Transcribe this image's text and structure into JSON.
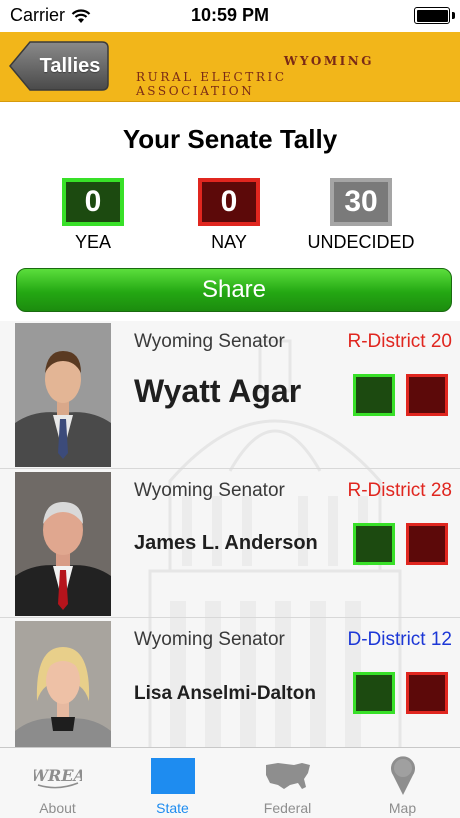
{
  "status_bar": {
    "carrier": "Carrier",
    "time": "10:59 PM"
  },
  "header": {
    "back_label": "Tallies",
    "logo_line1": "WYOMING",
    "logo_line2": "RURAL ELECTRIC ASSOCIATION"
  },
  "tally": {
    "title": "Your Senate Tally",
    "yea": {
      "count": "0",
      "label": "YEA"
    },
    "nay": {
      "count": "0",
      "label": "NAY"
    },
    "undecided": {
      "count": "30",
      "label": "UNDECIDED"
    }
  },
  "share_label": "Share",
  "senators": [
    {
      "role": "Wyoming Senator",
      "district": "R-District 20",
      "party": "R",
      "name": "Wyatt Agar"
    },
    {
      "role": "Wyoming Senator",
      "district": "R-District 28",
      "party": "R",
      "name": "James L. Anderson"
    },
    {
      "role": "Wyoming Senator",
      "district": "D-District 12",
      "party": "D",
      "name": "Lisa Anselmi-Dalton"
    }
  ],
  "tabs": [
    {
      "label": "About",
      "icon": "wrea-logo-icon",
      "active": false
    },
    {
      "label": "State",
      "icon": "wyoming-state-icon",
      "active": true
    },
    {
      "label": "Federal",
      "icon": "usa-map-icon",
      "active": false
    },
    {
      "label": "Map",
      "icon": "map-pin-icon",
      "active": false
    }
  ],
  "colors": {
    "header": "#f2b61a",
    "yea_fill": "#1c4a10",
    "yea_border": "#38e028",
    "nay_fill": "#5c0909",
    "nay_border": "#e0261f",
    "republican": "#e0261f",
    "democrat": "#1c37d6",
    "tab_active": "#1e8cf0",
    "tab_inactive": "#8e8e8e"
  }
}
